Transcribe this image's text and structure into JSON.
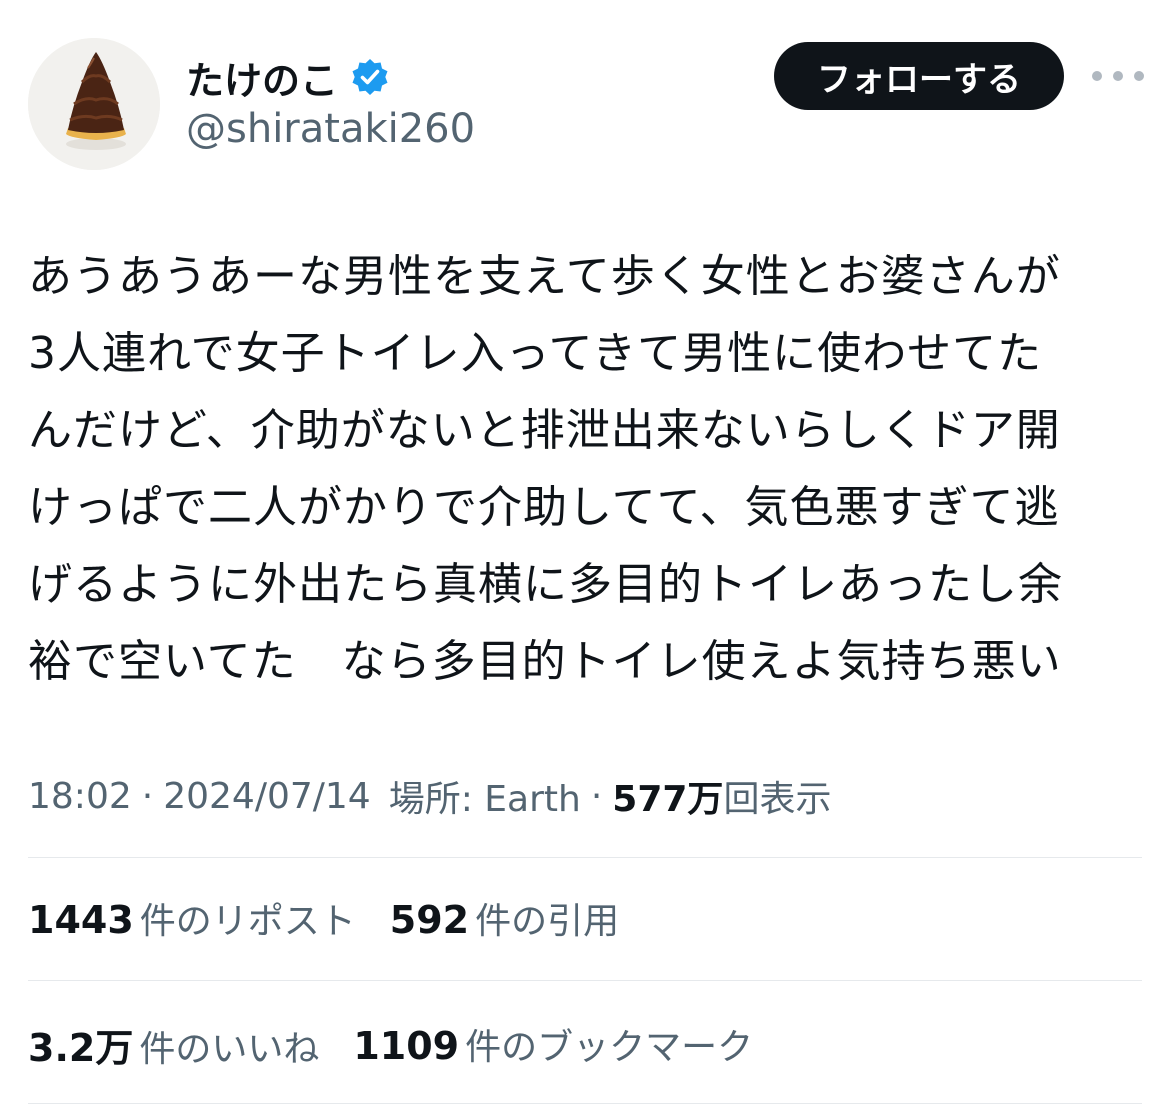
{
  "profile": {
    "display_name": "たけのこ",
    "handle": "@shirataki260",
    "verified": true,
    "avatar": "bamboo-shoot-chocolate-avatar"
  },
  "actions": {
    "follow_label": "フォローする",
    "more_icon": "more-options-icon"
  },
  "tweet": {
    "lines": [
      "あうあうあーな男性を支えて歩く女性とお婆さんが",
      "3人連れで女子トイレ入ってきて男性に使わせてた",
      "んだけど、介助がないと排泄出来ないらしくドア開",
      "けっぱで二人がかりで介助してて、気色悪すぎて逃",
      "げるように外出たら真横に多目的トイレあったし余",
      "裕で空いてた　なら多目的トイレ使えよ気持ち悪い"
    ]
  },
  "meta": {
    "time": "18:02",
    "separator": "·",
    "date": "2024/07/14",
    "location": "場所: Earth",
    "views_count": "577万",
    "views_label": "回表示"
  },
  "stats": {
    "reposts_count": "1443",
    "reposts_label": "件のリポスト",
    "quotes_count": "592",
    "quotes_label": "件の引用",
    "likes_count": "3.2万",
    "likes_label": "件のいいね",
    "bookmarks_count": "1109",
    "bookmarks_label": "件のブックマーク"
  },
  "colors": {
    "text_primary": "#0f1419",
    "text_secondary": "#536471",
    "verified_blue": "#1d9bf0",
    "divider": "#e6e9ec",
    "follow_bg": "#0f1419"
  }
}
